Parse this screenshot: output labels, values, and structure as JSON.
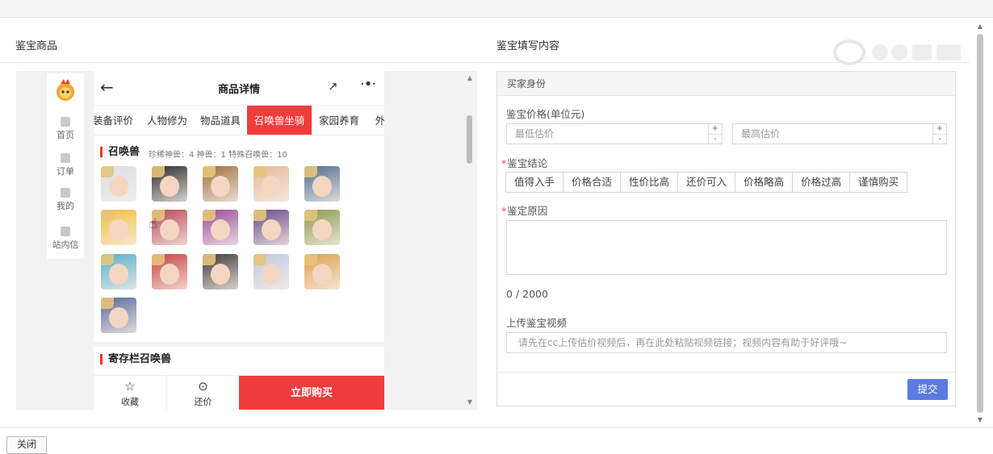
{
  "left_panel": {
    "title": "鉴宝商品"
  },
  "right_panel": {
    "title": "鉴宝填写内容"
  },
  "close_label": "关闭",
  "phone": {
    "sidebar": [
      {
        "label": "首页",
        "icon": "home-icon"
      },
      {
        "label": "订单",
        "icon": "order-icon"
      },
      {
        "label": "我的",
        "icon": "user-icon"
      },
      {
        "label": "站内信",
        "icon": "mail-icon"
      }
    ],
    "header_title": "商品详情",
    "tabs": [
      "装备评价",
      "人物修为",
      "物品道具",
      "召唤兽坐骑",
      "家园养育",
      "外"
    ],
    "active_tab": "召唤兽坐骑",
    "section1": {
      "title": "召唤兽",
      "stats": "珍稀神兽：4  神兽：1  特殊召唤兽：10"
    },
    "pet_colors": [
      "#d7dde4",
      "#2c2a2a",
      "#a0703f",
      "#e6b89a",
      "#4f6c8f",
      "#f0c040",
      "#b8475a",
      "#9a4c9c",
      "#6a4a8a",
      "#8c9a4f",
      "#56b0c8",
      "#c84040",
      "#3a3a3a",
      "#c0c8e0",
      "#e0a050",
      "#5a6a9a"
    ],
    "section2": {
      "title": "寄存栏召唤兽"
    },
    "bottom": {
      "fav": "收藏",
      "bargain": "还价",
      "buy": "立即购买"
    }
  },
  "form": {
    "buyer_identity": "买家身份",
    "price_label": "鉴宝价格(单位元)",
    "min_placeholder": "最低估价",
    "max_placeholder": "最高估价",
    "conclusion_label": "鉴宝结论",
    "conclusions": [
      "值得入手",
      "价格合适",
      "性价比高",
      "还价可入",
      "价格略高",
      "价格过高",
      "谨慎购买"
    ],
    "reason_label": "鉴定原因",
    "counter": "0 / 2000",
    "video_label": "上传鉴宝视频",
    "video_placeholder": "请先在cc上传估价视频后，再在此处粘贴视频链接；视频内容有助于好评哦~",
    "submit_label": "提交"
  },
  "colors": {
    "accent_red": "#f03c3c",
    "submit_blue": "#5a7be0"
  }
}
